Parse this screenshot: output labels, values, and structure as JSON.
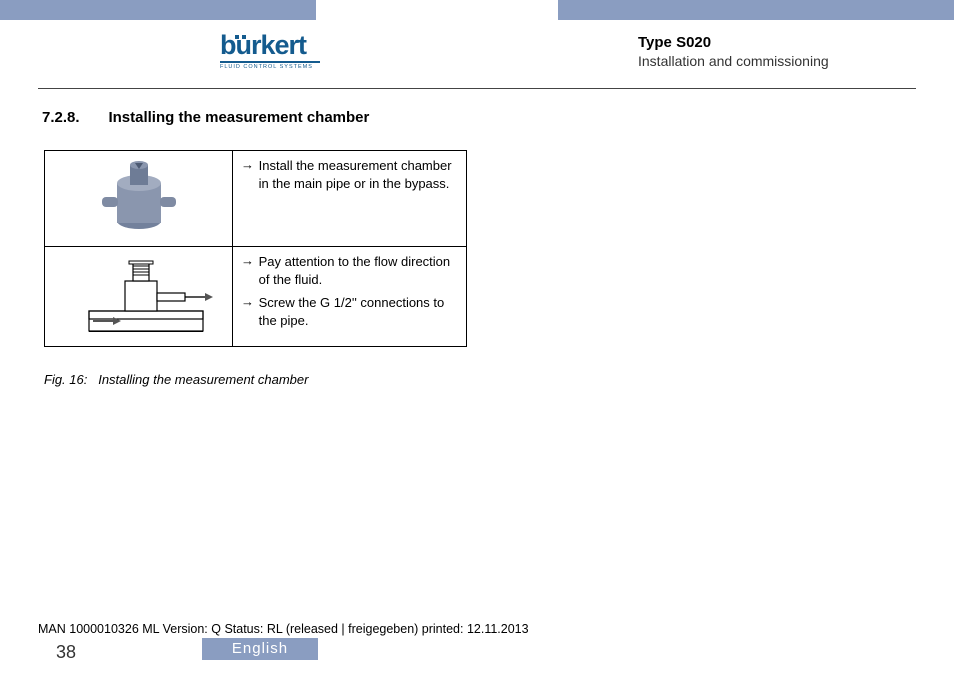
{
  "logo": {
    "name": "burkert",
    "tagline": "FLUID CONTROL SYSTEMS"
  },
  "doc": {
    "type": "Type S020",
    "subtitle": "Installation and commissioning"
  },
  "section": {
    "num": "7.2.8.",
    "title": "Installing the measurement chamber"
  },
  "steps": {
    "row1": "Install the measurement chamber in the main pipe or in the bypass.",
    "row2a": "Pay attention to the flow direction of the fluid.",
    "row2b": "Screw the G 1/2'' connections to the pipe."
  },
  "caption": {
    "label": "Fig. 16:",
    "text": "Installing the measurement chamber"
  },
  "footer": {
    "meta": "MAN 1000010326 ML Version: Q Status: RL (released | freigegeben) printed: 12.11.2013",
    "page": "38",
    "lang": "English"
  }
}
